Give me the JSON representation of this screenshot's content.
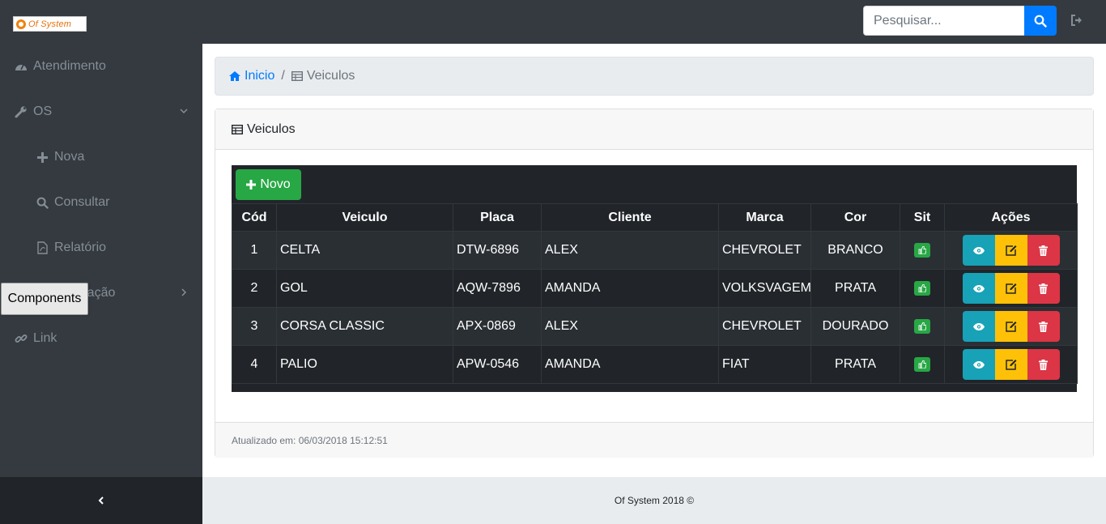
{
  "logo": {
    "text": "Of System",
    "accent": "#f0820f"
  },
  "search": {
    "placeholder": "Pesquisar...",
    "value": ""
  },
  "sidebar": {
    "items": [
      {
        "label": "Atendimento",
        "icon": "dashboard-icon"
      },
      {
        "label": "OS",
        "icon": "wrench-icon"
      },
      {
        "label": "Nova",
        "icon": "plus-icon"
      },
      {
        "label": "Consultar",
        "icon": "search-icon"
      },
      {
        "label": "Relatório",
        "icon": "file-pdf-icon"
      },
      {
        "label": "Administração",
        "icon": "user-icon"
      },
      {
        "label": "Link",
        "icon": "link-icon"
      }
    ],
    "tooltip": "Components"
  },
  "breadcrumb": {
    "home": "Inicio",
    "separator": "/",
    "current": "Veiculos"
  },
  "card": {
    "title": "Veiculos",
    "new_button": "Novo",
    "updated": "Atualizado em: 06/03/2018 15:12:51"
  },
  "table": {
    "headers": [
      "Cód",
      "Veiculo",
      "Placa",
      "Cliente",
      "Marca",
      "Cor",
      "Sit",
      "Ações"
    ],
    "rows": [
      [
        "1",
        "CELTA",
        "DTW-6896",
        "ALEX",
        "CHEVROLET",
        "BRANCO"
      ],
      [
        "2",
        "GOL",
        "AQW-7896",
        "AMANDA",
        "VOLKSVAGEM",
        "PRATA"
      ],
      [
        "3",
        "CORSA CLASSIC",
        "APX-0869",
        "ALEX",
        "CHEVROLET",
        "DOURADO"
      ],
      [
        "4",
        "PALIO",
        "APW-0546",
        "AMANDA",
        "FIAT",
        "PRATA"
      ]
    ]
  },
  "footer": {
    "text": "Of System 2018 ©"
  },
  "colors": {
    "sidebar": "#343a40",
    "primary": "#007bff",
    "success": "#28a745",
    "info": "#17a2b8",
    "warning": "#ffc107",
    "danger": "#dc3545"
  }
}
